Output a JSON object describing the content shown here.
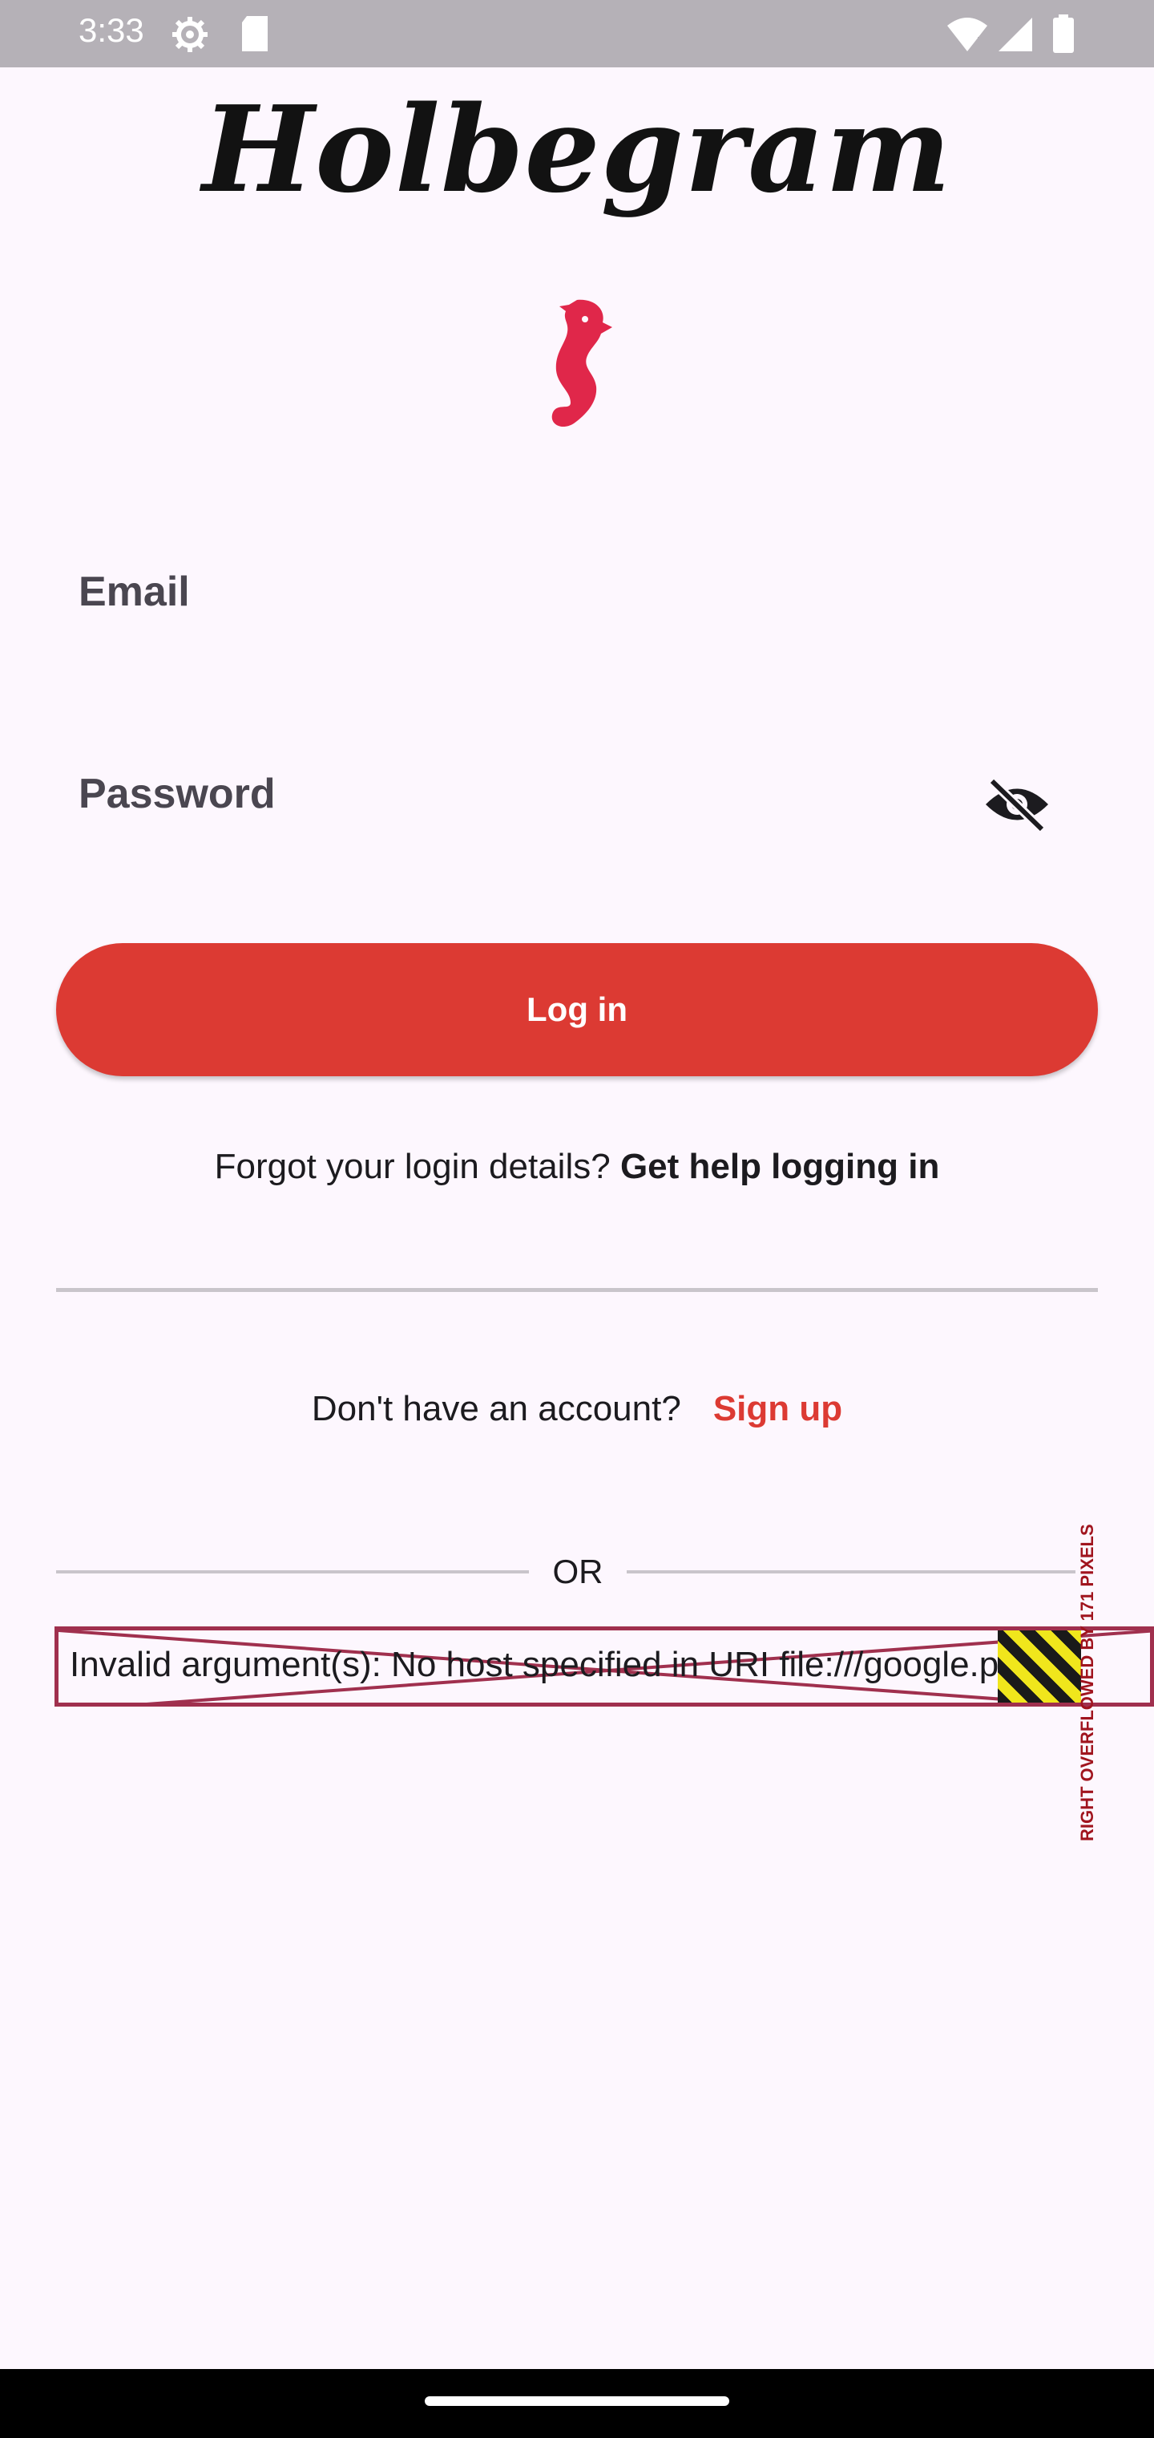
{
  "status_bar": {
    "time": "3:33",
    "icons_left": [
      "settings-icon",
      "sd-card-icon"
    ],
    "icons_right": [
      "wifi-icon",
      "signal-icon",
      "battery-icon"
    ]
  },
  "app": {
    "logo_text": "Holbegram",
    "logo_icon": "seahorse-icon",
    "brand_color": "#dc3a33",
    "icon_color": "#e0274a"
  },
  "form": {
    "email_label": "Email",
    "password_label": "Password",
    "password_toggle_icon": "eye-off-icon"
  },
  "login_button_label": "Log in",
  "forgot": {
    "prefix": "Forgot your login details?",
    "link": "Get help logging in"
  },
  "signup": {
    "prefix": "Don't have an account?",
    "link": "Sign up"
  },
  "or_separator": "OR",
  "error": {
    "message": "Invalid argument(s): No host specified in URI file:///google.png",
    "overflow_label": "RIGHT OVERFLOWED BY 171 PIXELS"
  }
}
